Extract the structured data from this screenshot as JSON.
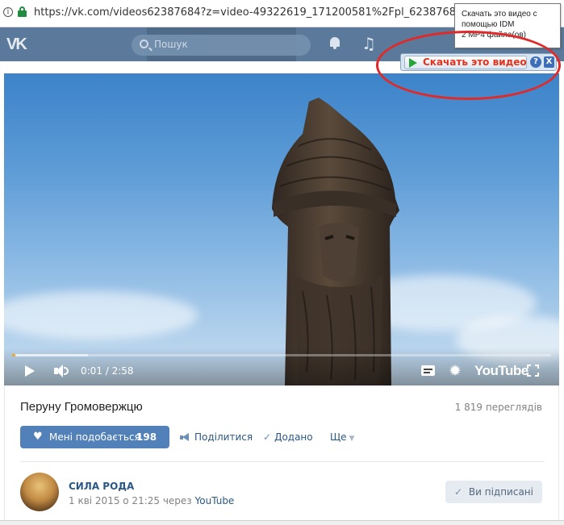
{
  "browser": {
    "url": "https://vk.com/videos62387684?z=video-49322619_171200581%2Fpl_62387684_-2"
  },
  "header": {
    "logo_icon": "vk-logo",
    "search_placeholder": "Пошук"
  },
  "idm": {
    "download_label": "Скачать это видео",
    "help_label": "?",
    "close_label": "X",
    "tooltip_line1": "Скачать это видео с",
    "tooltip_line2": "помощью IDM",
    "tooltip_line3": "2 MP4 файла(ов)"
  },
  "player": {
    "current_time": "0:01",
    "duration": "2:58",
    "time_display": "0:01 / 2:58",
    "played_fraction": 0.006,
    "loaded_fraction": 0.14,
    "brand": "YouTube"
  },
  "video": {
    "title": "Перуну Громовержцю",
    "views": "1 819 переглядів",
    "like_label": "Мені подобається",
    "like_count": "198",
    "share_label": "Поділитися",
    "added_label": "Додано",
    "more_label": "Ще"
  },
  "channel": {
    "name": "СИЛА РОДА",
    "date": "1 кві 2015 о 21:25 через",
    "source": "YouTube",
    "subscribed_label": "Ви підписані"
  },
  "colors": {
    "vk_blue": "#5181b8",
    "link": "#2a5885",
    "idm_red": "#e3321c",
    "highlight_ellipse": "#e02a2a"
  }
}
